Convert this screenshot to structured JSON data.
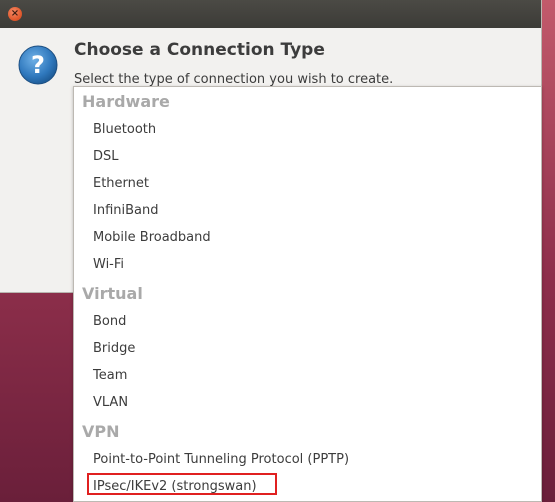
{
  "window": {
    "close_label": "×"
  },
  "dialog": {
    "title": "Choose a Connection Type",
    "subtitle": "Select the type of connection you wish to create."
  },
  "popup": {
    "groups": [
      {
        "header": "Hardware",
        "items": [
          "Bluetooth",
          "DSL",
          "Ethernet",
          "InfiniBand",
          "Mobile Broadband",
          "Wi-Fi"
        ]
      },
      {
        "header": "Virtual",
        "items": [
          "Bond",
          "Bridge",
          "Team",
          "VLAN"
        ]
      },
      {
        "header": "VPN",
        "items": [
          "Point-to-Point Tunneling Protocol (PPTP)",
          "IPsec/IKEv2 (strongswan)"
        ]
      }
    ]
  },
  "colors": {
    "highlight_border": "#e02020",
    "question_icon_fill": "#3a86c8"
  }
}
